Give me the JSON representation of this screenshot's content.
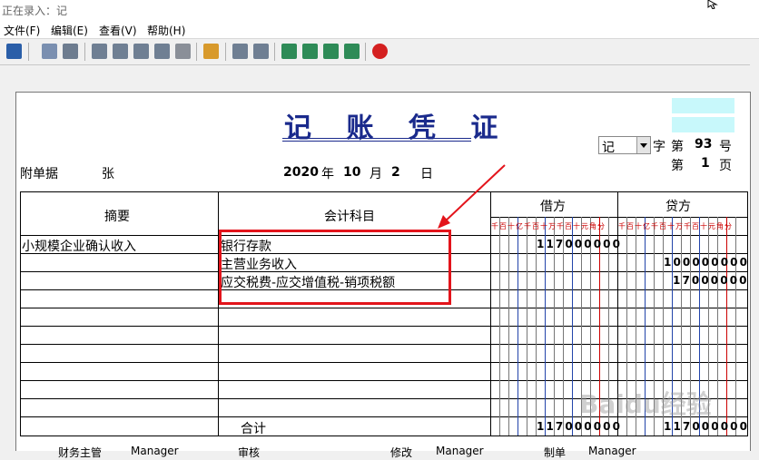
{
  "window": {
    "title": "正在录入：记"
  },
  "menu": {
    "file": "文件(F)",
    "edit": "编辑(E)",
    "view": "查看(V)",
    "help": "帮助(H)"
  },
  "toolbar": {
    "icons": [
      "save-icon",
      "form-icon",
      "print-icon",
      "add-icon",
      "copy-icon",
      "book-icon",
      "voucher-icon",
      "folder-icon",
      "user-icon",
      "calculator-icon",
      "chart-icon",
      "first-icon",
      "prev-icon",
      "next-icon",
      "last-icon",
      "close-icon"
    ]
  },
  "voucher": {
    "title": "记 账 凭 证",
    "type_value": "记",
    "zi_label": "字",
    "di_label": "第",
    "number": "93",
    "hao_label": "号",
    "page_num": "1",
    "ye_label": "页",
    "attach_label": "附单据",
    "attach_count": "张",
    "year": "2020",
    "year_label": "年",
    "month": "10",
    "month_label": "月",
    "day": "2",
    "day_label": "日",
    "headers": {
      "summary": "摘要",
      "account": "会计科目",
      "debit": "借方",
      "credit": "贷方"
    },
    "units": "千百十亿千百十万千百十元角分",
    "rows": [
      {
        "summary": "小规模企业确认收入",
        "account": "银行存款",
        "debit": "117000000",
        "credit": ""
      },
      {
        "summary": "",
        "account": "主营业务收入",
        "debit": "",
        "credit": "100000000"
      },
      {
        "summary": "",
        "account": "应交税费-应交增值税-销项税额",
        "debit": "",
        "credit": "17000000"
      }
    ],
    "total_label": "合计",
    "total_debit": "117000000",
    "total_credit": "117000000"
  },
  "footer": {
    "supervisor_label": "财务主管",
    "supervisor_value": "Manager",
    "audit_label": "审核",
    "bookkeep_label": "修改",
    "bookkeep_value": "Manager",
    "maker_label": "制单",
    "maker_value": "Manager"
  },
  "watermark": {
    "text": "Baidu经验"
  },
  "colors": {
    "title": "#1a2a8c",
    "highlight": "#e3141b",
    "cyan": "#c8f8fb"
  }
}
